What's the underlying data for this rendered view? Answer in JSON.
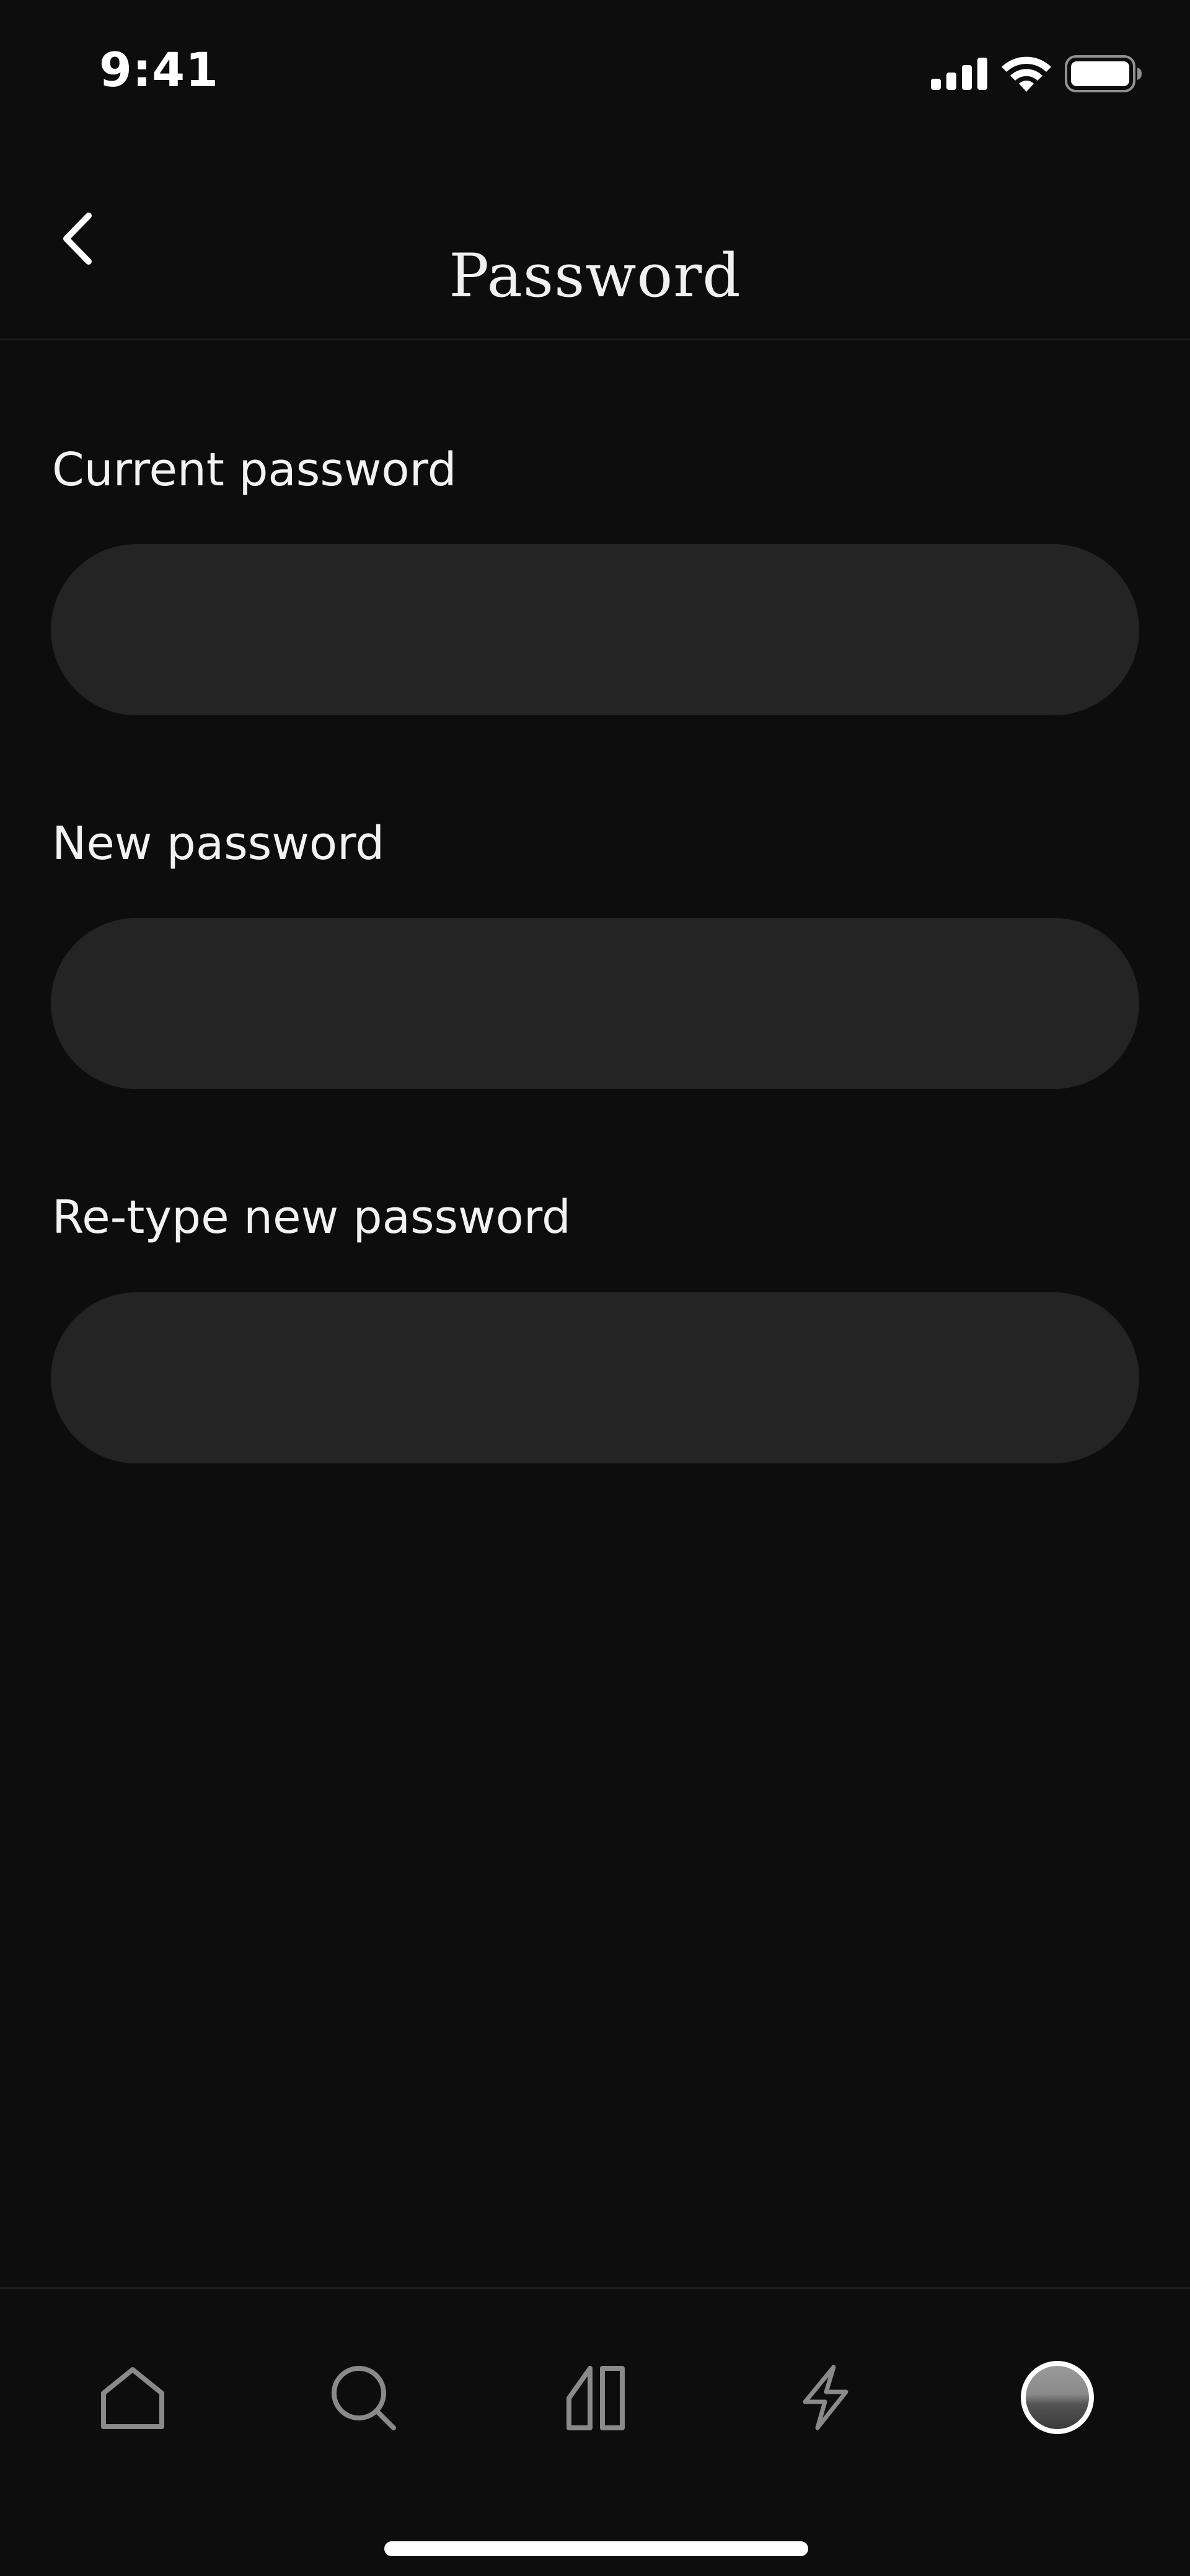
{
  "status_bar": {
    "time": "9:41",
    "icons": [
      "cellular-signal-icon",
      "wifi-icon",
      "battery-icon"
    ]
  },
  "header": {
    "title": "Password",
    "back_icon": "chevron-left-icon"
  },
  "form": {
    "fields": [
      {
        "label": "Current password",
        "value": "",
        "placeholder": ""
      },
      {
        "label": "New password",
        "value": "",
        "placeholder": ""
      },
      {
        "label": "Re-type new password",
        "value": "",
        "placeholder": ""
      }
    ]
  },
  "tab_bar": {
    "items": [
      {
        "name": "home",
        "icon": "home-icon"
      },
      {
        "name": "search",
        "icon": "search-icon"
      },
      {
        "name": "library",
        "icon": "library-icon"
      },
      {
        "name": "activity",
        "icon": "lightning-icon"
      },
      {
        "name": "profile",
        "icon": "avatar"
      }
    ],
    "selected": "profile"
  },
  "colors": {
    "background": "#0d0d0d",
    "input_background": "#242424",
    "text": "#ffffff",
    "tab_icon_inactive": "#8a8a8a"
  }
}
